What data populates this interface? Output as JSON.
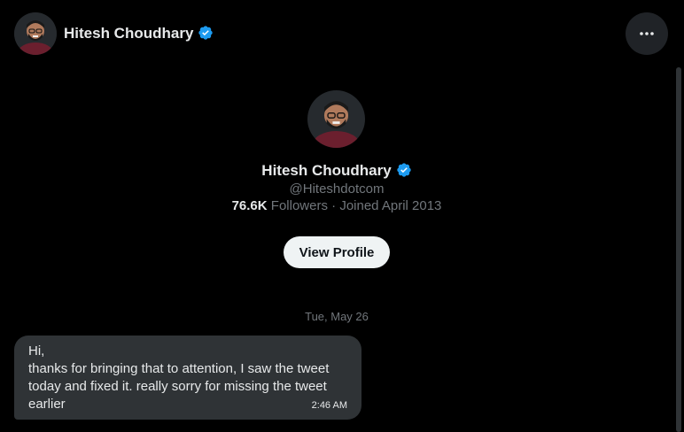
{
  "header": {
    "name": "Hitesh Choudhary",
    "verified_icon": "verified-badge-icon",
    "more_icon": "more-options-icon"
  },
  "profile": {
    "name": "Hitesh Choudhary",
    "handle": "@Hiteshdotcom",
    "followers_count": "76.6K",
    "followers_label": "Followers",
    "separator": "·",
    "joined": "Joined April 2013",
    "view_profile_label": "View Profile"
  },
  "conversation": {
    "date": "Tue, May 26",
    "messages": [
      {
        "lines": [
          "Hi,",
          "thanks for bringing that to attention, I saw the tweet",
          "today and fixed it. really sorry for missing the tweet",
          "earlier"
        ],
        "time": "2:46 AM"
      }
    ]
  },
  "colors": {
    "background": "#000000",
    "primary_text": "#e7e9ea",
    "secondary_text": "#71767b",
    "bubble": "#2f3336",
    "verified": "#1d9bf0",
    "button": "#eff3f4"
  }
}
